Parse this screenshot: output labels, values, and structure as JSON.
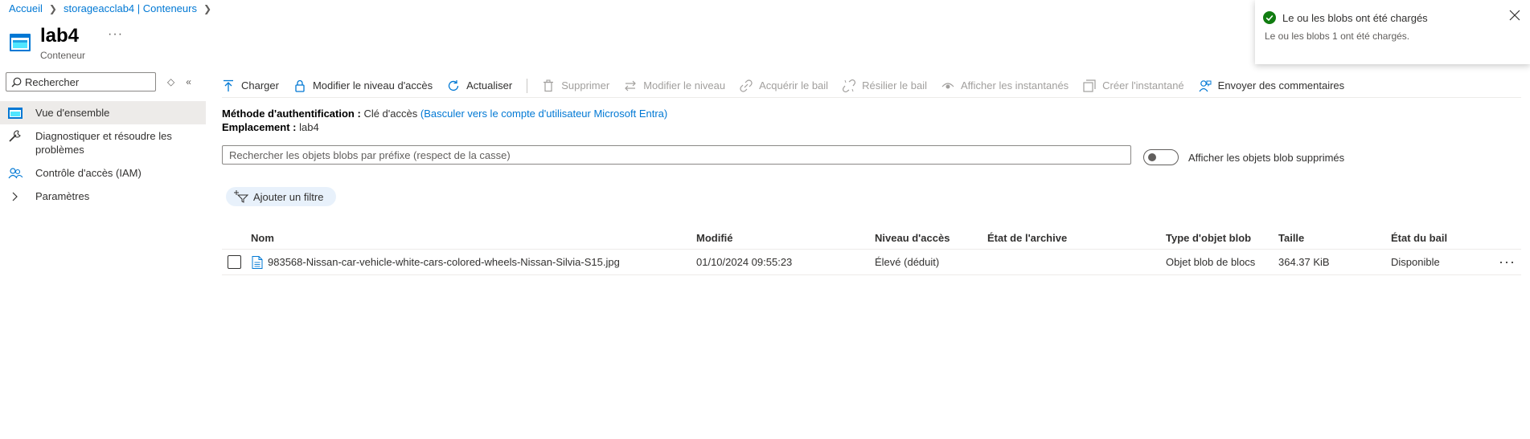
{
  "breadcrumb": {
    "items": [
      "Accueil",
      "storageacclab4 | Conteneurs"
    ]
  },
  "header": {
    "title": "lab4",
    "subtitle": "Conteneur",
    "more": "···"
  },
  "sidebar": {
    "search_placeholder": "Rechercher",
    "items": [
      {
        "label": "Vue d'ensemble",
        "icon": "container-icon",
        "active": true
      },
      {
        "label": "Diagnostiquer et résoudre les problèmes",
        "icon": "wrench-icon"
      },
      {
        "label": "Contrôle d'accès (IAM)",
        "icon": "people-icon"
      },
      {
        "label": "Paramètres",
        "icon": "chevron-right-icon"
      }
    ]
  },
  "commands": {
    "upload": "Charger",
    "change_access_level": "Modifier le niveau d'accès",
    "refresh": "Actualiser",
    "delete": "Supprimer",
    "change_tier": "Modifier le niveau",
    "acquire_lease": "Acquérir le bail",
    "break_lease": "Résilier le bail",
    "view_snapshots": "Afficher les instantanés",
    "create_snapshot": "Créer l'instantané",
    "feedback": "Envoyer des commentaires"
  },
  "info": {
    "auth_label": "Méthode d'authentification :",
    "auth_value": "Clé d'accès",
    "auth_link": "(Basculer vers le compte d'utilisateur Microsoft Entra)",
    "location_label": "Emplacement :",
    "location_value": "lab4"
  },
  "blob_search": {
    "placeholder": "Rechercher les objets blobs par préfixe (respect de la casse)"
  },
  "toggle": {
    "label": "Afficher les objets blob supprimés",
    "on": false
  },
  "filter": {
    "label": "Ajouter un filtre"
  },
  "table": {
    "columns": {
      "name": "Nom",
      "modified": "Modifié",
      "access_tier": "Niveau d'accès",
      "archive_status": "État de l'archive",
      "blob_type": "Type d'objet blob",
      "size": "Taille",
      "lease_state": "État du bail"
    },
    "rows": [
      {
        "name": "983568-Nissan-car-vehicle-white-cars-colored-wheels-Nissan-Silvia-S15.jpg",
        "modified": "01/10/2024 09:55:23",
        "access_tier": "Élevé (déduit)",
        "archive_status": "",
        "blob_type": "Objet blob de blocs",
        "size": "364.37 KiB",
        "lease_state": "Disponible",
        "more": "···"
      }
    ]
  },
  "notification": {
    "title": "Le ou les blobs ont été chargés",
    "body": "Le ou les blobs 1 ont été chargés.",
    "status_color": "#107c10"
  },
  "colors": {
    "accent": "#0078d4",
    "success": "#107c10",
    "disabled": "#a19f9d"
  }
}
